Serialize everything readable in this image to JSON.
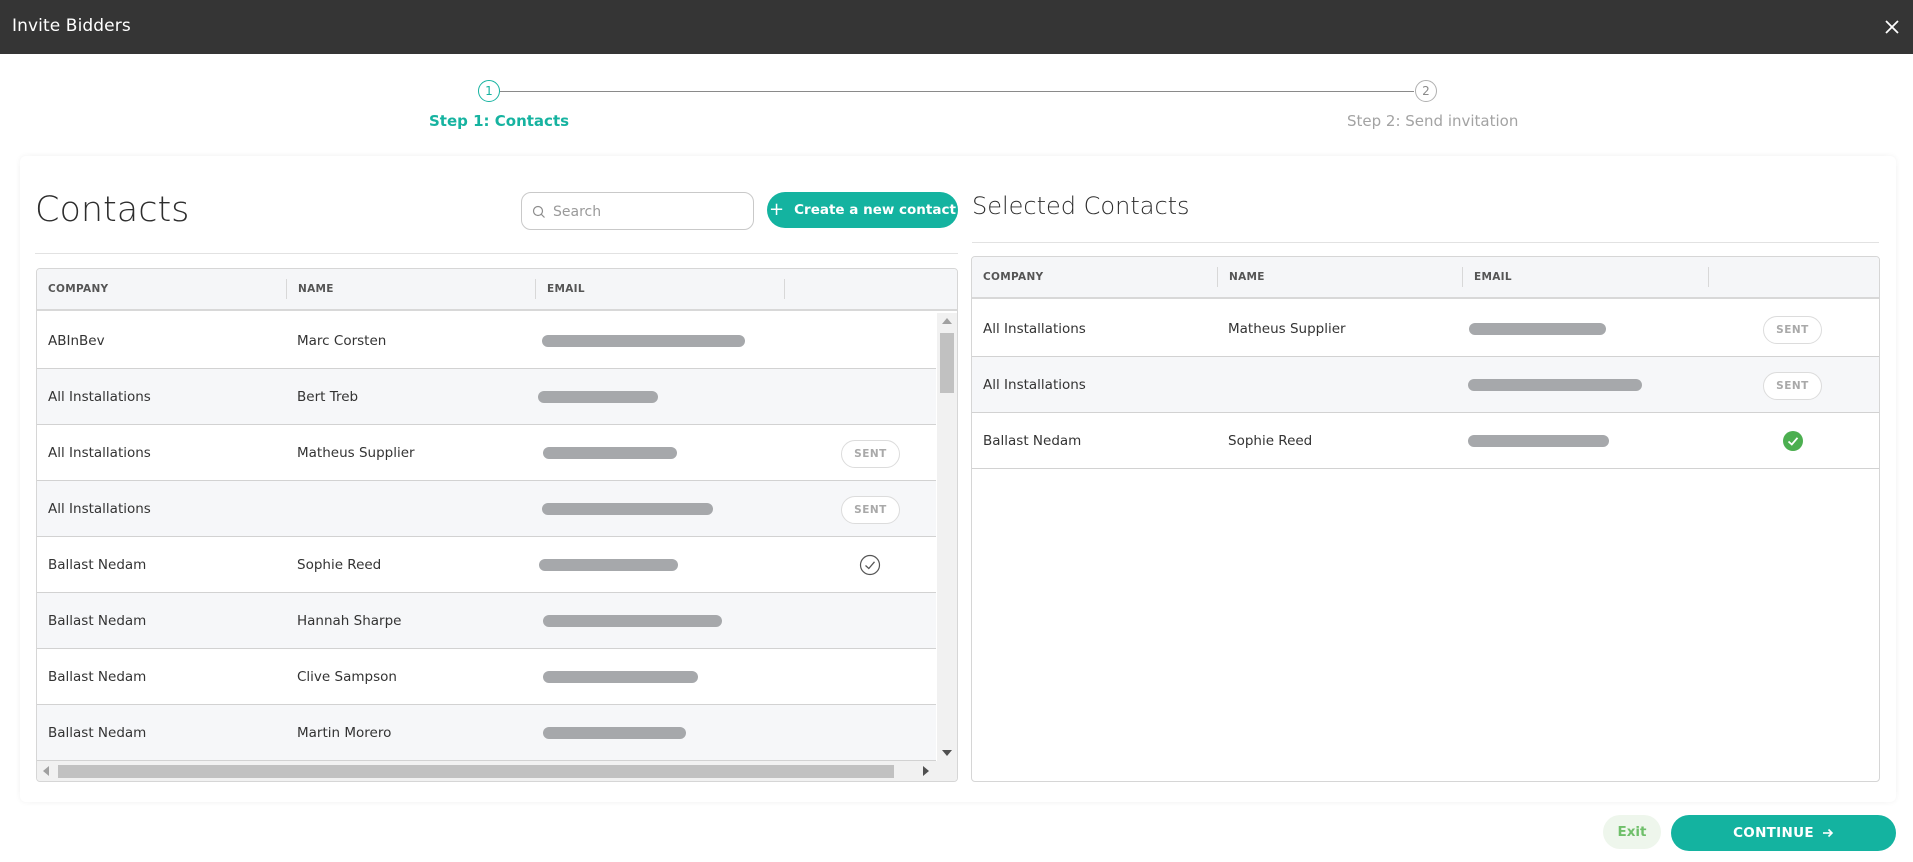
{
  "window": {
    "title": "Invite Bidders"
  },
  "stepper": {
    "step1": {
      "number": "1",
      "label": "Step 1: Contacts"
    },
    "step2": {
      "number": "2",
      "label": "Step 2: Send invitation"
    }
  },
  "contacts": {
    "title": "Contacts",
    "search_placeholder": "Search",
    "create_button": "Create a new contact",
    "columns": [
      "COMPANY",
      "NAME",
      "EMAIL"
    ],
    "rows": [
      {
        "company": "ABInBev",
        "name": "Marc Corsten",
        "status": ""
      },
      {
        "company": "All Installations",
        "name": "Bert Treb",
        "status": ""
      },
      {
        "company": "All Installations",
        "name": "Matheus Supplier",
        "status": "SENT"
      },
      {
        "company": "All Installations",
        "name": "",
        "status": "SENT"
      },
      {
        "company": "Ballast Nedam",
        "name": "Sophie Reed",
        "status": "selected"
      },
      {
        "company": "Ballast Nedam",
        "name": "Hannah Sharpe",
        "status": ""
      },
      {
        "company": "Ballast Nedam",
        "name": "Clive Sampson",
        "status": ""
      },
      {
        "company": "Ballast Nedam",
        "name": "Martin Morero",
        "status": ""
      }
    ]
  },
  "selected": {
    "title": "Selected Contacts",
    "columns": [
      "COMPANY",
      "NAME",
      "EMAIL"
    ],
    "rows": [
      {
        "company": "All Installations",
        "name": "Matheus Supplier",
        "status": "SENT"
      },
      {
        "company": "All Installations",
        "name": "",
        "status": "SENT"
      },
      {
        "company": "Ballast Nedam",
        "name": "Sophie Reed",
        "status": "added"
      }
    ]
  },
  "footer": {
    "exit_label": "Exit",
    "continue_label": "CONTINUE"
  },
  "colors": {
    "accent": "#14b3a0",
    "success": "#4caf50",
    "titlebar": "#353535"
  }
}
